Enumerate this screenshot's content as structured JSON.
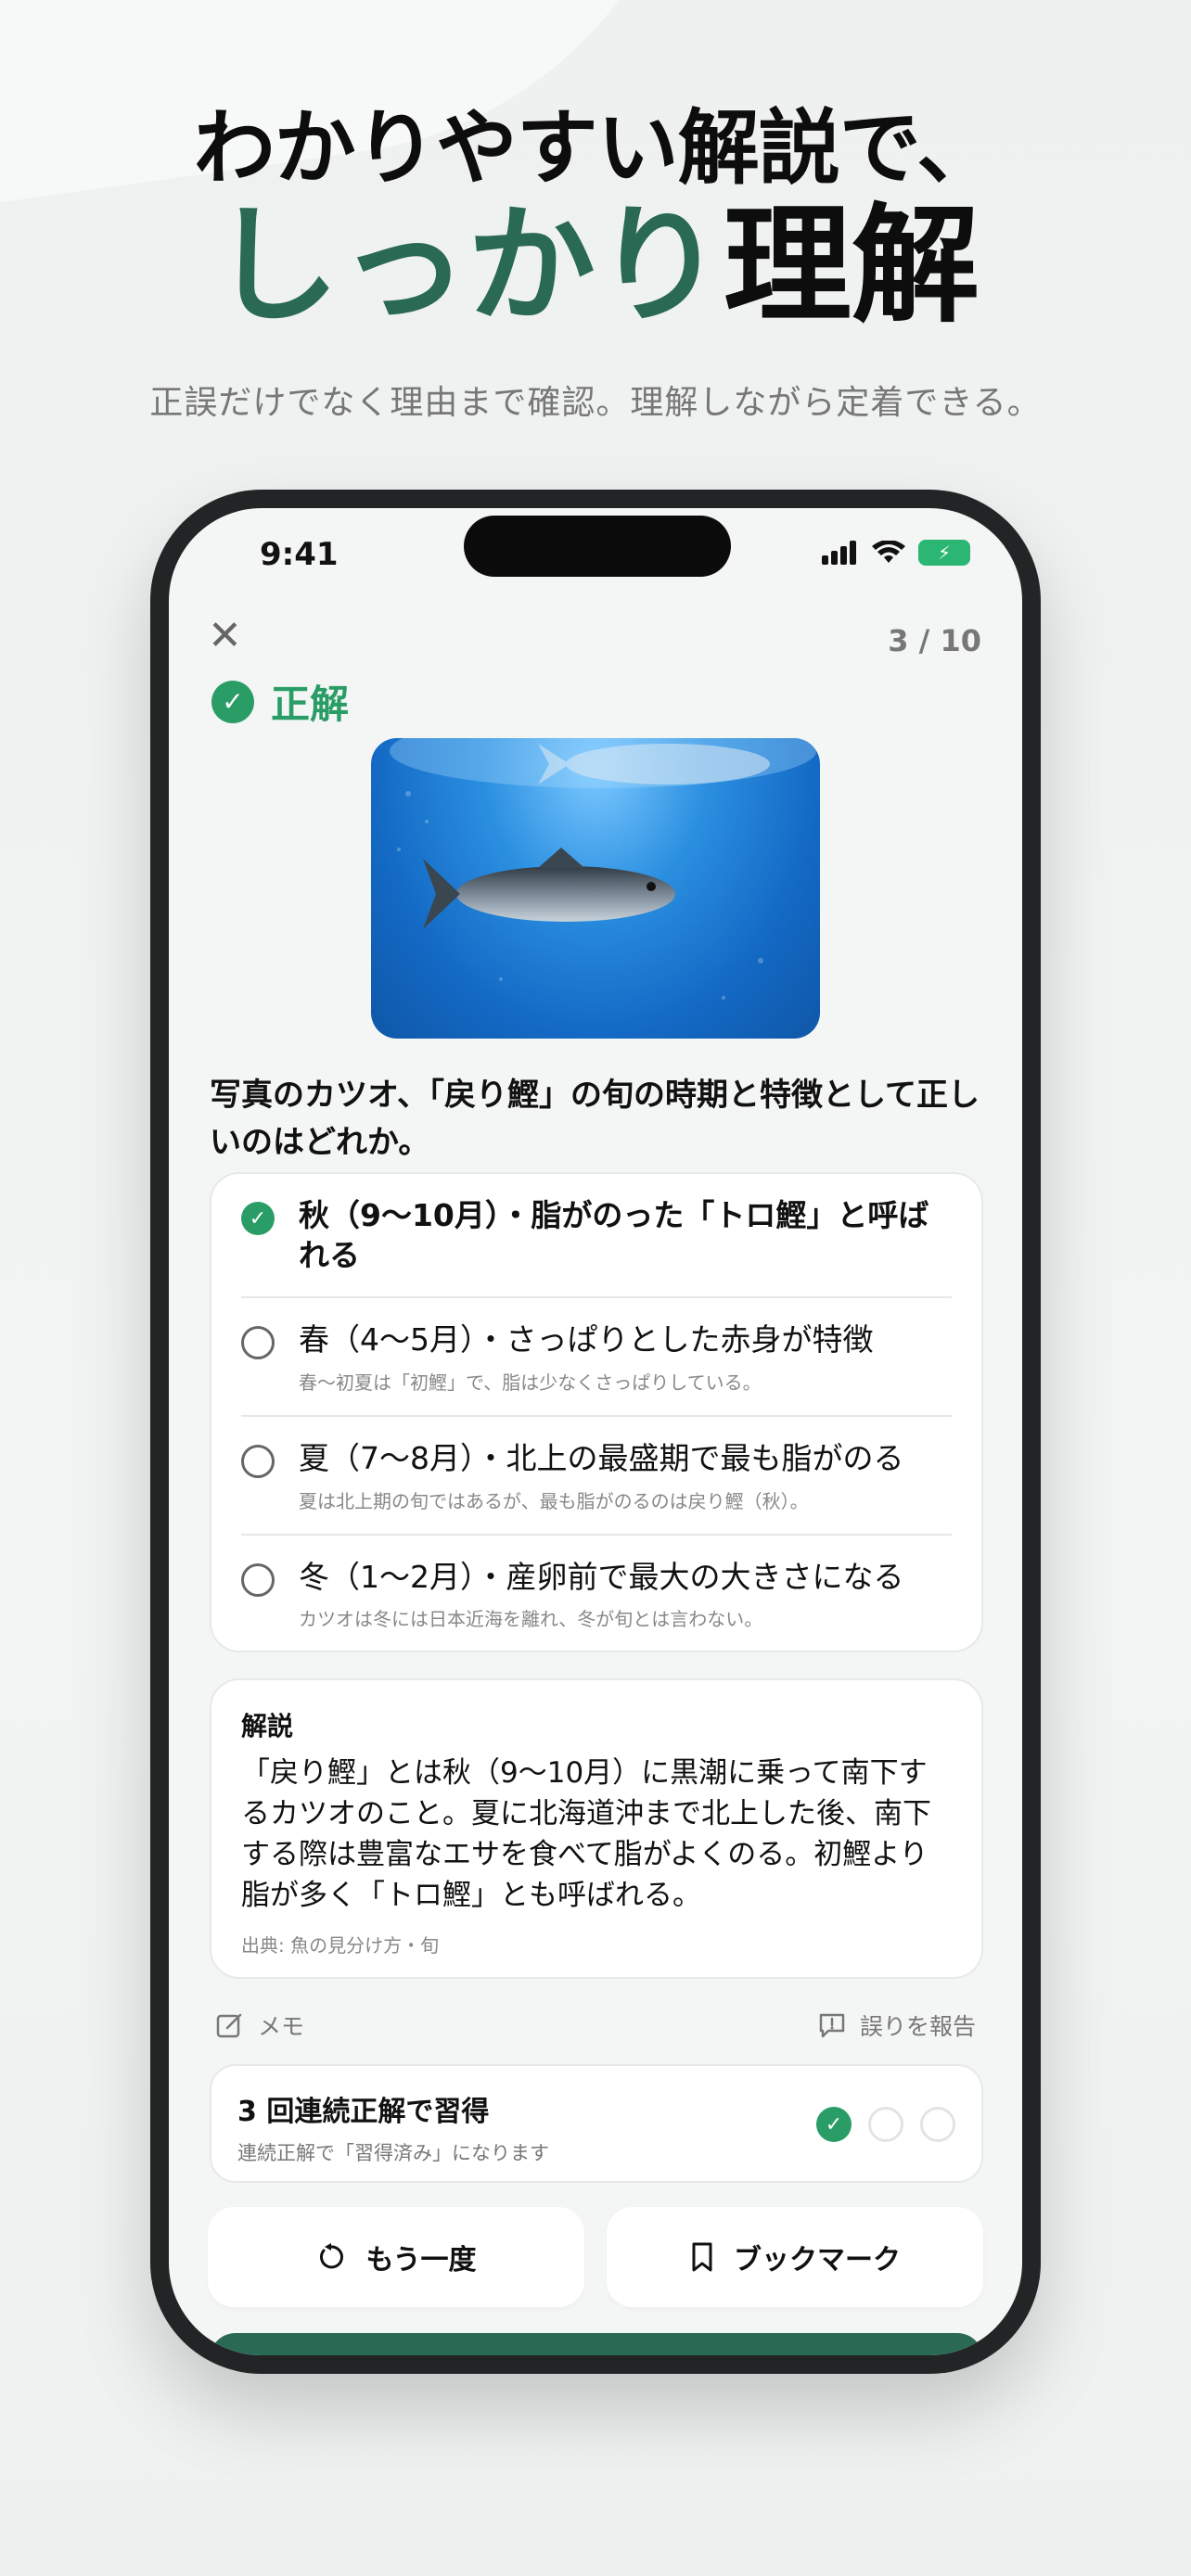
{
  "promo": {
    "headline_line1": "わかりやすい解説で、",
    "headline_accent": "しっかり",
    "headline_rest": "理解",
    "subheadline": "正誤だけでなく理由まで確認。理解しながら定着できる。"
  },
  "status_bar": {
    "time": "9:41"
  },
  "quiz": {
    "progress": "3 / 10",
    "result_label": "正解",
    "image_alt": "katsuo-fish-photo",
    "question": "写真のカツオ、「戻り鰹」の旬の時期と特徴として正しいのはどれか。",
    "options": [
      {
        "text": "秋（9〜10月）・脂がのった「トロ鰹」と呼ばれる",
        "note": "",
        "selected": true
      },
      {
        "text": "春（4〜5月）・さっぱりとした赤身が特徴",
        "note": "春〜初夏は「初鰹」で、脂は少なくさっぱりしている。",
        "selected": false
      },
      {
        "text": "夏（7〜8月）・北上の最盛期で最も脂がのる",
        "note": "夏は北上期の旬ではあるが、最も脂がのるのは戻り鰹（秋）。",
        "selected": false
      },
      {
        "text": "冬（1〜2月）・産卵前で最大の大きさになる",
        "note": "カツオは冬には日本近海を離れ、冬が旬とは言わない。",
        "selected": false
      }
    ]
  },
  "explanation": {
    "title": "解説",
    "body": "「戻り鰹」とは秋（9〜10月）に黒潮に乗って南下するカツオのこと。夏に北海道沖まで北上した後、南下する際は豊富なエサを食べて脂がよくのる。初鰹より脂が多く「トロ鰹」とも呼ばれる。",
    "source": "出典: 魚の見分け方・旬"
  },
  "actions": {
    "memo": "メモ",
    "report": "誤りを報告",
    "retry": "もう一度",
    "bookmark": "ブックマーク"
  },
  "streak": {
    "title": "3 回連続正解で習得",
    "subtitle": "連続正解で「習得済み」になります",
    "completed": 1,
    "total": 3
  },
  "colors": {
    "accent_dark": "#2a6a55",
    "correct_green": "#2a9d66"
  }
}
